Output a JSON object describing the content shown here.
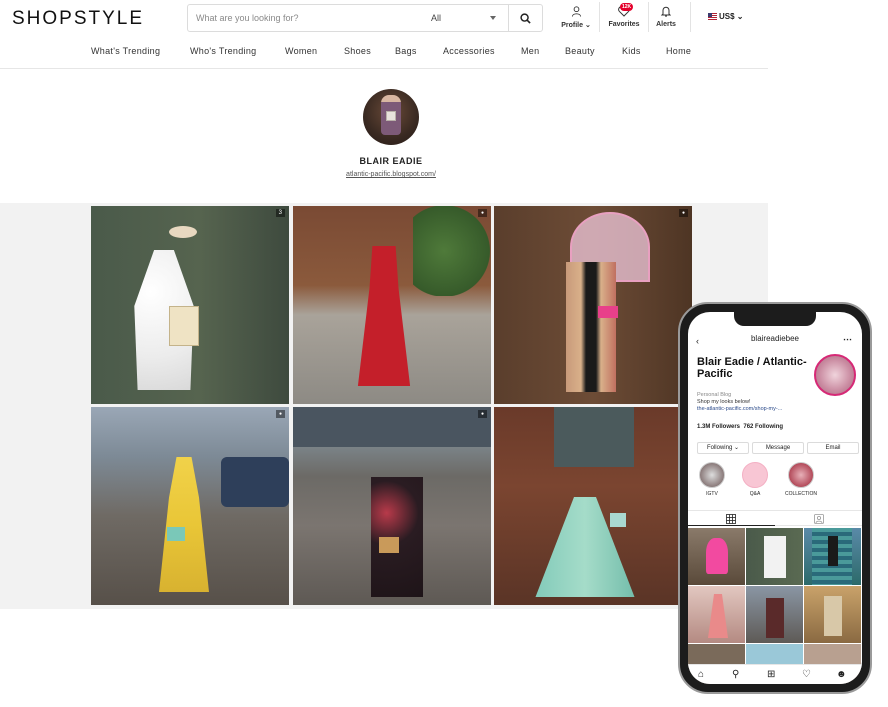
{
  "brand": {
    "logo": "SHOPSTYLE"
  },
  "search": {
    "placeholder": "What are you looking for?",
    "category": "All"
  },
  "header": {
    "profile": "Profile",
    "favorites": "Favorites",
    "favorites_badge": "12K",
    "alerts": "Alerts",
    "currency": "US$"
  },
  "nav": {
    "items": [
      "What's Trending",
      "Who's Trending",
      "Women",
      "Shoes",
      "Bags",
      "Accessories",
      "Men",
      "Beauty",
      "Kids",
      "Home"
    ]
  },
  "profile": {
    "name": "BLAIR EADIE",
    "link": "atlantic-pacific.blogspot.com/"
  },
  "gallery": {
    "badge_first": "3"
  },
  "instagram": {
    "username": "blaireadiebee",
    "display_name": "Blair Eadie / Atlantic-Pacific",
    "category": "Personal Blog",
    "bio": "Shop my looks below!",
    "link": "the-atlantic-pacific.com/shop-my-...",
    "followers": "1.3M Followers",
    "following": "762 Following",
    "buttons": {
      "following": "Following",
      "message": "Message",
      "email": "Email"
    },
    "highlights": [
      "IGTV",
      "Q&A",
      "COLLECTION"
    ]
  },
  "colors": {
    "accent": "#e4002b",
    "ig_ring": "#d62976"
  }
}
